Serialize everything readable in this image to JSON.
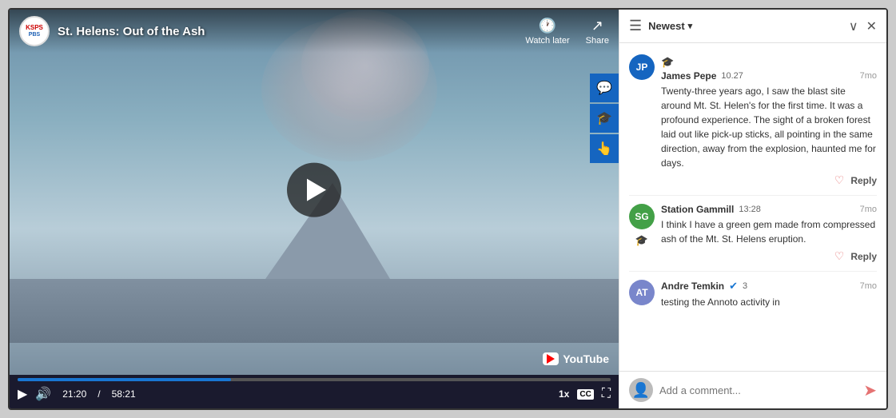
{
  "window": {
    "title": "St. Helens: Out of the Ash"
  },
  "video": {
    "title": "St. Helens: Out of the Ash",
    "logo_top": "KSPS",
    "logo_bot": "PBS",
    "watch_later_label": "Watch later",
    "share_label": "Share",
    "current_time": "21:20",
    "total_time": "58:21",
    "separator": "/",
    "speed_label": "1x",
    "progress_percent": 36,
    "youtube_label": "YouTube"
  },
  "comments": {
    "sort_label": "Newest",
    "comment1": {
      "author": "James Pepe",
      "points": "10.27",
      "time": "7mo",
      "text": "Twenty-three years ago, I saw the blast site around Mt. St. Helen's for the first time. It was a profound experience. The sight of a broken forest laid out like pick-up sticks, all pointing in the same direction, away from the explosion, haunted me for days.",
      "initials": "JP",
      "avatar_color": "#1565c0",
      "reply_label": "Reply"
    },
    "comment2": {
      "author": "Station Gammill",
      "points": "13:28",
      "time": "7mo",
      "text": "I think I have a green gem made from compressed ash of the Mt. St. Helens eruption.",
      "initials": "SG",
      "avatar_color": "#43a047",
      "reply_label": "Reply"
    },
    "comment3": {
      "author": "Andre Temkin",
      "verified_count": "3",
      "time": "7mo",
      "text": "testing the Annoto activity in",
      "initials": "AT",
      "avatar_color": "#7986cb"
    },
    "add_comment_placeholder": "Add a comment..."
  }
}
